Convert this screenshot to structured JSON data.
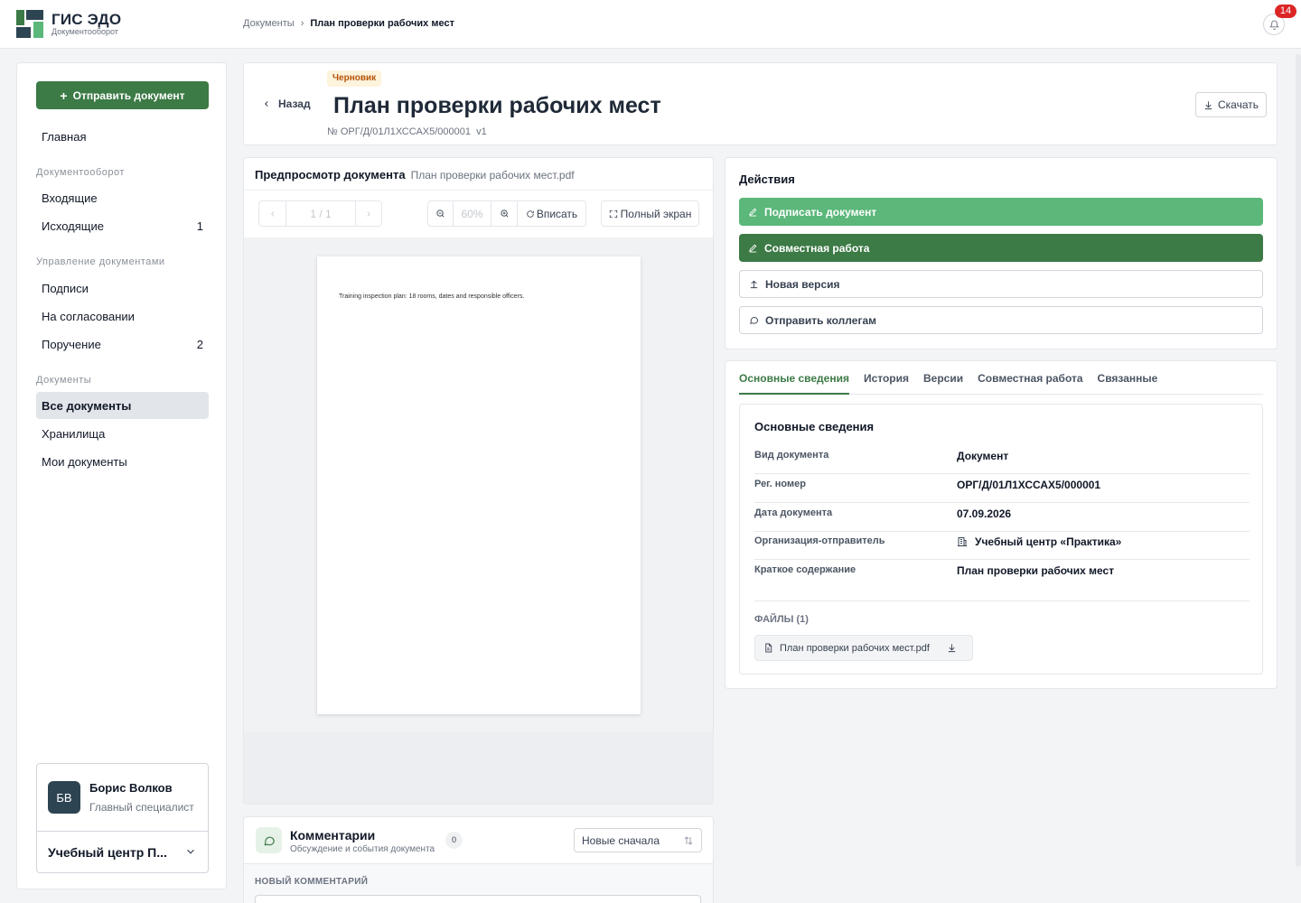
{
  "app": {
    "title": "ГИС ЭДО",
    "subtitle": "Документооборот",
    "notifications": "14"
  },
  "breadcrumb": {
    "root": "Документы",
    "separator": "›",
    "current": "План проверки рабочих мест"
  },
  "sidebar": {
    "send_button": "Отправить документ",
    "home": "Главная",
    "sections": [
      {
        "title": "Документооборот",
        "items": [
          {
            "label": "Входящие",
            "count": ""
          },
          {
            "label": "Исходящие",
            "count": "1"
          }
        ]
      },
      {
        "title": "Управление документами",
        "items": [
          {
            "label": "Подписи",
            "count": ""
          },
          {
            "label": "На согласовании",
            "count": ""
          },
          {
            "label": "Поручение",
            "count": "2"
          }
        ]
      },
      {
        "title": "Документы",
        "items": [
          {
            "label": "Все документы",
            "count": ""
          },
          {
            "label": "Хранилища",
            "count": ""
          },
          {
            "label": "Мои документы",
            "count": ""
          }
        ]
      }
    ],
    "user": {
      "initials": "БВ",
      "name": "Борис Волков",
      "role": "Главный специалист",
      "org": "Учебный центр П..."
    }
  },
  "document": {
    "status": "Черновик",
    "back": "Назад",
    "title": "План проверки рабочих мест",
    "number": "№ ОРГ/Д/01Л1ХССАХ5/000001",
    "version": "v1",
    "download": "Скачать"
  },
  "preview": {
    "title": "Предпросмотр документа",
    "filename": "План проверки рабочих мест.pdf",
    "page_indicator": "1 / 1",
    "zoom": "60%",
    "fit": "Вписать",
    "fullscreen": "Полный экран",
    "page_text": "Training inspection plan: 18 rooms, dates and responsible officers."
  },
  "comments": {
    "title": "Комментарии",
    "subtitle": "Обсуждение и события документа",
    "count": "0",
    "sort": "Новые сначала",
    "new_label": "НОВЫЙ КОММЕНТАРИЙ"
  },
  "actions": {
    "title": "Действия",
    "buttons": [
      "Подписать документ",
      "Совместная работа",
      "Новая версия",
      "Отправить коллегам"
    ]
  },
  "info": {
    "tabs": [
      "Основные сведения",
      "История",
      "Версии",
      "Совместная работа",
      "Связанные"
    ],
    "section_title": "Основные сведения",
    "rows": [
      {
        "label": "Вид документа",
        "value": "Документ"
      },
      {
        "label": "Рег. номер",
        "value": "ОРГ/Д/01Л1ХССАХ5/000001"
      },
      {
        "label": "Дата документа",
        "value": "07.09.2026"
      },
      {
        "label": "Организация-отправитель",
        "value": "Учебный центр «Практика»"
      },
      {
        "label": "Краткое содержание",
        "value": "План проверки рабочих мест"
      }
    ],
    "files_title": "ФАЙЛЫ (1)",
    "file": "План проверки рабочих мест.pdf"
  },
  "colors": {
    "accent": "#3c7a46",
    "accent_light": "#5bb77a",
    "draft_badge": "#fef3dc",
    "notification": "#dc2626"
  }
}
